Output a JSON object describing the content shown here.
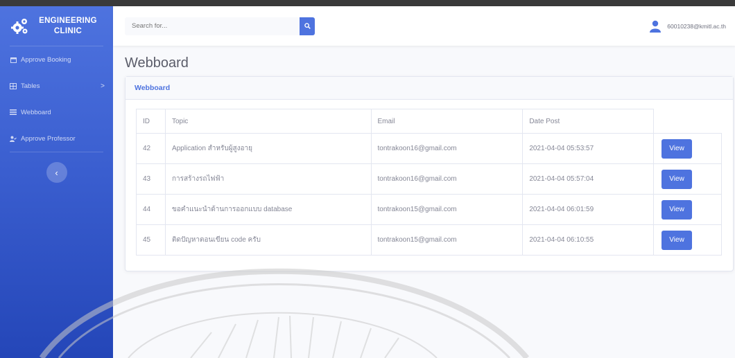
{
  "sidebar": {
    "brand": {
      "line1": "ENGINEERING",
      "line2": "CLINIC",
      "icon": "gears-icon"
    },
    "items": [
      {
        "label": "Approve Booking",
        "icon": "calendar-icon"
      },
      {
        "label": "Tables",
        "icon": "table-icon",
        "chevron": ">"
      },
      {
        "label": "Webboard",
        "icon": "list-icon"
      },
      {
        "label": "Approve Professor",
        "icon": "user-check-icon"
      }
    ],
    "toggle_symbol": "‹"
  },
  "navbar": {
    "search_placeholder": "Search for...",
    "search_icon": "search-icon",
    "user_email": "60010238@kmitl.ac.th",
    "user_icon": "user-icon"
  },
  "page": {
    "title": "Webboard",
    "card_title": "Webboard"
  },
  "table": {
    "headers": [
      "ID",
      "Topic",
      "Email",
      "Date Post"
    ],
    "rows": [
      {
        "id": "42",
        "topic": "Application สำหรับผู้สูงอายุ",
        "email": "tontrakoon16@gmail.com",
        "date": "2021-04-04 05:53:57",
        "action": "View"
      },
      {
        "id": "43",
        "topic": "การสร้างรถไฟฟ้า",
        "email": "tontrakoon16@gmail.com",
        "date": "2021-04-04 05:57:04",
        "action": "View"
      },
      {
        "id": "44",
        "topic": "ขอคำแนะนำด้านการออกแบบ database",
        "email": "tontrakoon15@gmail.com",
        "date": "2021-04-04 06:01:59",
        "action": "View"
      },
      {
        "id": "45",
        "topic": "ติดปัญหาตอนเขียน code ครับ",
        "email": "tontrakoon15@gmail.com",
        "date": "2021-04-04 06:10:55",
        "action": "View"
      }
    ]
  },
  "colors": {
    "primary": "#4e73df",
    "sidebar_dark": "#2446b8",
    "text_muted": "#858796"
  }
}
